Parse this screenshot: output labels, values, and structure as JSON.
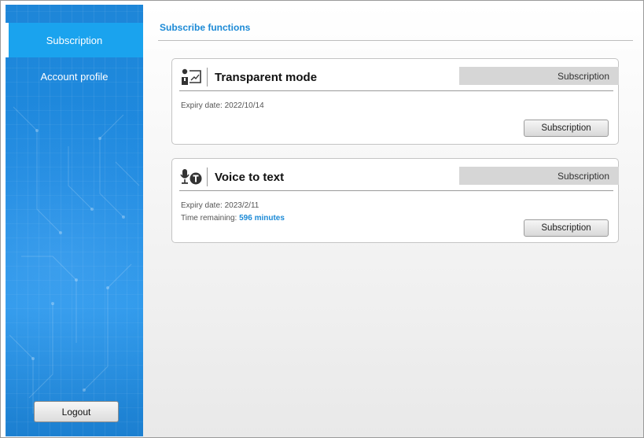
{
  "sidebar": {
    "items": [
      {
        "label": "Subscription",
        "active": true
      },
      {
        "label": "Account profile",
        "active": false
      }
    ],
    "logout_label": "Logout",
    "background_color": "#1e86d8",
    "active_color": "#1aa3ee"
  },
  "main": {
    "title": "Subscribe functions",
    "title_color": "#1c8ad6",
    "cards": [
      {
        "icon": "transparent-mode-icon",
        "title": "Transparent mode",
        "status": "Subscription",
        "expiry": "Expiry date: 2022/10/14",
        "button_label": "Subscription"
      },
      {
        "icon": "voice-to-text-icon",
        "title": "Voice to text",
        "status": "Subscription",
        "expiry": "Expiry date: 2023/2/11",
        "time_remaining_label": "Time remaining: ",
        "time_remaining_value": "596 minutes",
        "button_label": "Subscription"
      }
    ]
  }
}
